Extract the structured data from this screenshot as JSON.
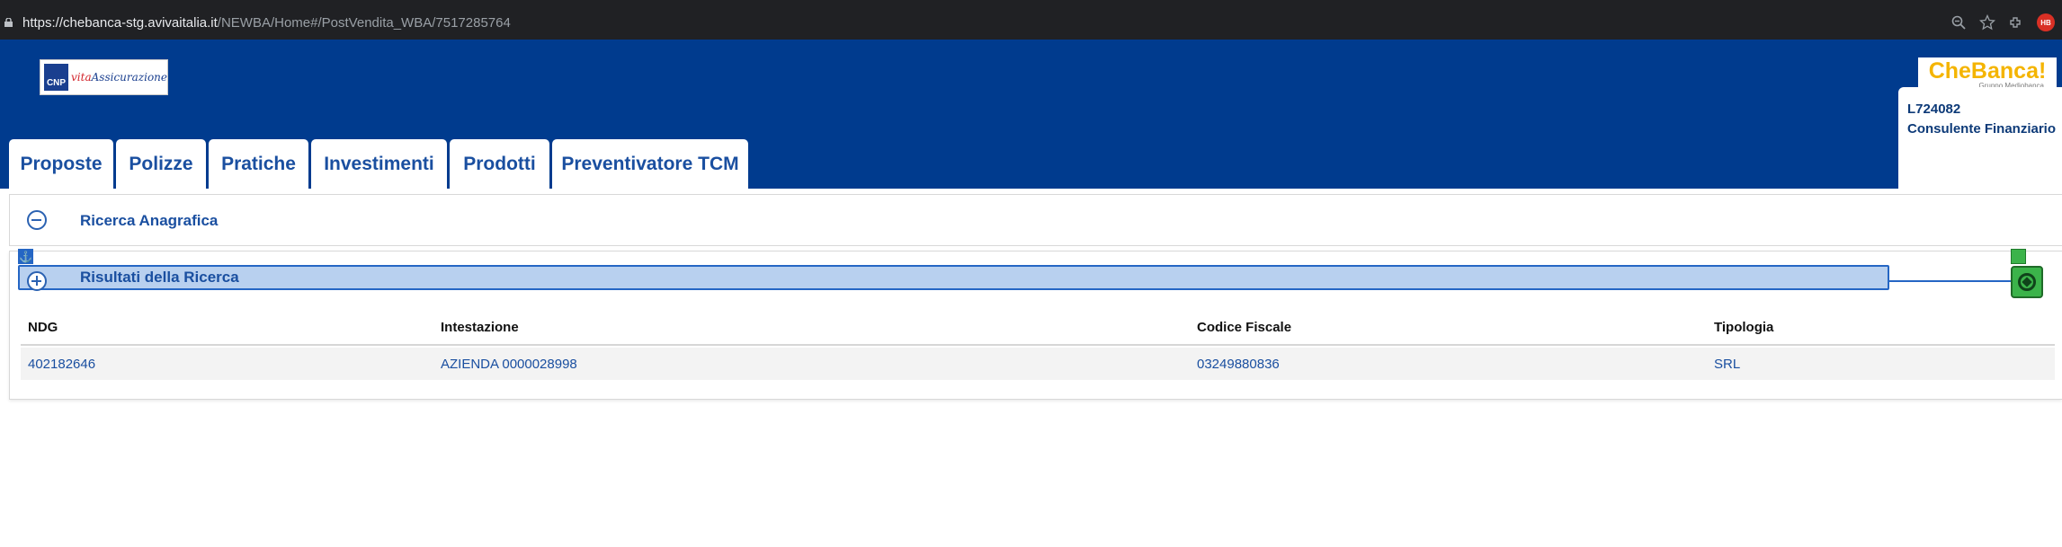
{
  "browser": {
    "url_host": "https://chebanca-stg.avivaitalia.it",
    "url_path": "/NEWBA/Home#/PostVendita_WBA/7517285764",
    "ext_badge": "HB"
  },
  "header": {
    "logo_left": {
      "cnp": "CNP",
      "vita": "vita",
      "assicurazione": "Assicurazione"
    },
    "logo_right": {
      "brand": "CheBanca!",
      "group": "Gruppo Mediobanca"
    },
    "user": {
      "code": "L724082",
      "role": "Consulente Finanziario"
    }
  },
  "nav": {
    "tabs": [
      {
        "label": "Proposte"
      },
      {
        "label": "Polizze"
      },
      {
        "label": "Pratiche"
      },
      {
        "label": "Investimenti"
      },
      {
        "label": "Prodotti"
      },
      {
        "label": "Preventivatore TCM"
      }
    ]
  },
  "panels": {
    "search": {
      "title": "Ricerca Anagrafica"
    },
    "results": {
      "title": "Risultati della Ricerca"
    }
  },
  "table": {
    "headers": [
      "NDG",
      "Intestazione",
      "Codice Fiscale",
      "Tipologia"
    ],
    "rows": [
      [
        "402182646",
        "AZIENDA 0000028998",
        "03249880836",
        "SRL"
      ]
    ]
  },
  "colors": {
    "header_bg": "#003b8e",
    "accent": "#1a4fa0",
    "brand_yellow": "#f4b400"
  }
}
